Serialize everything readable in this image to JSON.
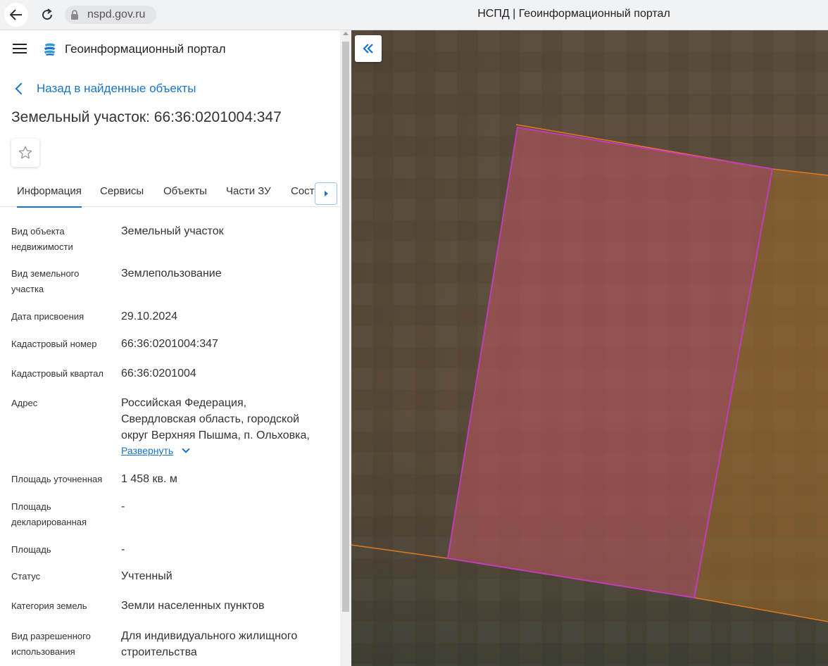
{
  "browser": {
    "url": "nspd.gov.ru",
    "tab_title": "НСПД | Геоинформационный портал"
  },
  "app": {
    "title": "Геоинформационный портал",
    "back_link": "Назад в найденные объекты",
    "object_title": "Земельный участок: 66:36:0201004:347"
  },
  "tabs": [
    {
      "label": "Информация",
      "active": true
    },
    {
      "label": "Сервисы",
      "active": false
    },
    {
      "label": "Объекты",
      "active": false
    },
    {
      "label": "Части ЗУ",
      "active": false
    },
    {
      "label": "Состав",
      "active": false
    }
  ],
  "info": {
    "rows": [
      {
        "label": "Вид объекта недвижимости",
        "value": "Земельный участок"
      },
      {
        "label": "Вид земельного участка",
        "value": "Землепользование"
      },
      {
        "label": "Дата присвоения",
        "value": "29.10.2024"
      },
      {
        "label": "Кадастровый номер",
        "value": "66:36:0201004:347"
      },
      {
        "label": "Кадастровый квартал",
        "value": "66:36:0201004"
      },
      {
        "label": "Адрес",
        "value": "Российская Федерация, Свердловская область, городской округ Верхняя Пышма, п. Ольховка,"
      },
      {
        "label": "Площадь уточненная",
        "value": "1 458 кв. м"
      },
      {
        "label": "Площадь декларированная",
        "value": "-"
      },
      {
        "label": "Площадь",
        "value": "-"
      },
      {
        "label": "Статус",
        "value": "Учтенный"
      },
      {
        "label": "Категория земель",
        "value": "Земли населенных пунктов"
      },
      {
        "label": "Вид разрешенного использования",
        "value": "Для индивидуального жилищного строительства"
      }
    ],
    "expand_label": "Развернуть"
  },
  "colors": {
    "accent": "#1a73c9",
    "parcel_fill": "#b55a6a",
    "parcel_stroke": "#c23cb8",
    "boundary": "#e8741e"
  }
}
